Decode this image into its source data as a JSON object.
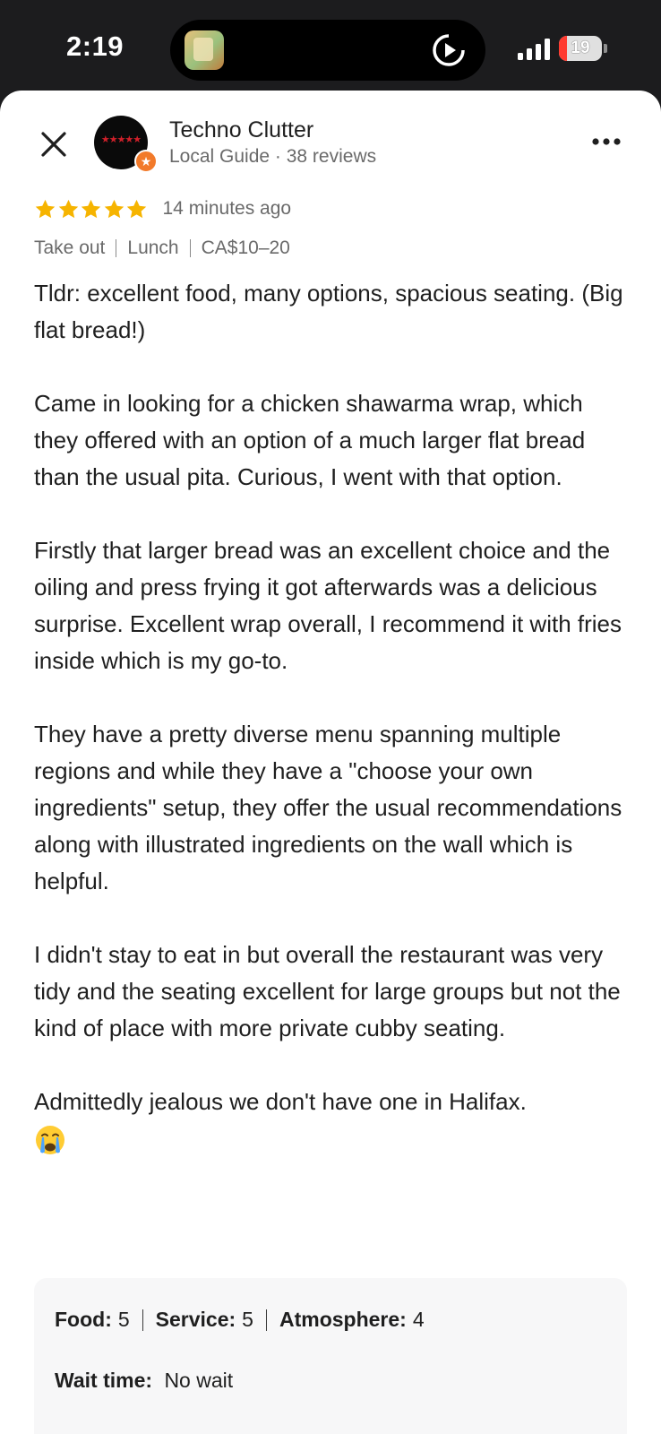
{
  "status_bar": {
    "time": "2:19",
    "battery_level": "19",
    "battery_fraction": 0.19,
    "battery_color": "#ff3b30"
  },
  "review": {
    "author_name": "Techno Clutter",
    "author_meta": "Local Guide · 38 reviews",
    "rating": 5,
    "rating_max": 5,
    "star_color": "#f6b400",
    "time_ago": "14 minutes ago",
    "tags": [
      "Take out",
      "Lunch",
      "CA$10–20"
    ],
    "paragraphs": [
      "Tldr: excellent food, many options, spacious seating. (Big flat bread!)",
      "Came in looking for a chicken shawarma wrap, which they offered with an option of a much larger flat bread than the usual pita. Curious, I went with that option.",
      "Firstly that larger bread was an excellent choice and the oiling and press frying it got afterwards was a delicious surprise. Excellent wrap overall, I recommend it with fries inside which is my go-to.",
      "They have a pretty diverse menu spanning multiple regions and while they have a \"choose your own ingredients\" setup, they offer the usual recommendations along with illustrated ingredients on the wall which is helpful.",
      "I didn't stay to eat in but overall the restaurant was very tidy and the seating excellent for large groups but not the kind of place with more private cubby seating.",
      "Admittedly jealous we don't have one in Halifax."
    ],
    "final_emoji": "crying-face-icon",
    "sub_ratings": {
      "food_label": "Food:",
      "food_value": "5",
      "service_label": "Service:",
      "service_value": "5",
      "atmosphere_label": "Atmosphere:",
      "atmosphere_value": "4"
    },
    "wait_time": {
      "label": "Wait time:",
      "value": "No wait"
    }
  }
}
